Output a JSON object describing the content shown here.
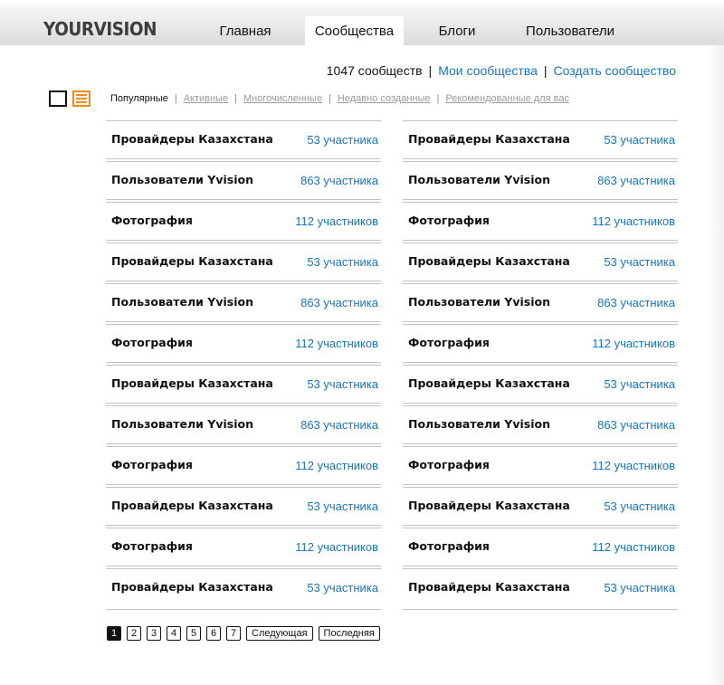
{
  "header": {
    "logo": "YOURVISION",
    "nav": [
      {
        "label": "Главная",
        "active": false
      },
      {
        "label": "Сообщества",
        "active": true
      },
      {
        "label": "Блоги",
        "active": false
      },
      {
        "label": "Пользователи",
        "active": false
      }
    ]
  },
  "summary": {
    "count": "1047 сообществ",
    "my_communities": "Мои сообщества",
    "create_community": "Создать сообщество"
  },
  "view_icons": [
    "grid-view-icon",
    "list-view-icon"
  ],
  "filters": {
    "items": [
      "Популярные",
      "Активные",
      "Многочисленные",
      "Недавно созданные",
      "Рекомендованные для вас"
    ],
    "selected": "Популярные"
  },
  "left_column": [
    {
      "name": "Провайдеры Казахстана",
      "members": "53 участника"
    },
    {
      "name": "Пользователи Yvision",
      "members": "863 участника"
    },
    {
      "name": "Фотография",
      "members": "112 участников"
    },
    {
      "name": "Провайдеры Казахстана",
      "members": "53 участника"
    },
    {
      "name": "Пользователи Yvision",
      "members": "863 участника"
    },
    {
      "name": "Фотография",
      "members": "112 участников"
    },
    {
      "name": "Провайдеры Казахстана",
      "members": "53 участника"
    },
    {
      "name": "Пользователи Yvision",
      "members": "863 участника"
    },
    {
      "name": "Фотография",
      "members": "112 участников"
    },
    {
      "name": "Провайдеры Казахстана",
      "members": "53 участника"
    },
    {
      "name": "Фотография",
      "members": "112 участников"
    },
    {
      "name": "Провайдеры Казахстана",
      "members": "53 участника"
    }
  ],
  "right_column": [
    {
      "name": "Провайдеры Казахстана",
      "members": "53 участника"
    },
    {
      "name": "Пользователи Yvision",
      "members": "863 участника"
    },
    {
      "name": "Фотография",
      "members": "112 участников"
    },
    {
      "name": "Провайдеры Казахстана",
      "members": "53 участника"
    },
    {
      "name": "Пользователи Yvision",
      "members": "863 участника"
    },
    {
      "name": "Фотография",
      "members": "112 участников"
    },
    {
      "name": "Провайдеры Казахстана",
      "members": "53 участника"
    },
    {
      "name": "Пользователи Yvision",
      "members": "863 участника"
    },
    {
      "name": "Фотография",
      "members": "112 участников"
    },
    {
      "name": "Провайдеры Казахстана",
      "members": "53 участника"
    },
    {
      "name": "Фотография",
      "members": "112 участников"
    },
    {
      "name": "Провайдеры Казахстана",
      "members": "53 участника"
    }
  ],
  "pagination": {
    "pages": [
      "1",
      "2",
      "3",
      "4",
      "5",
      "6",
      "7"
    ],
    "current": "1",
    "next_label": "Следующая",
    "last_label": "Последняя"
  },
  "colors": {
    "link": "#1775b9",
    "accent": "#f08a1e",
    "text": "#111111",
    "muted": "#999999"
  }
}
